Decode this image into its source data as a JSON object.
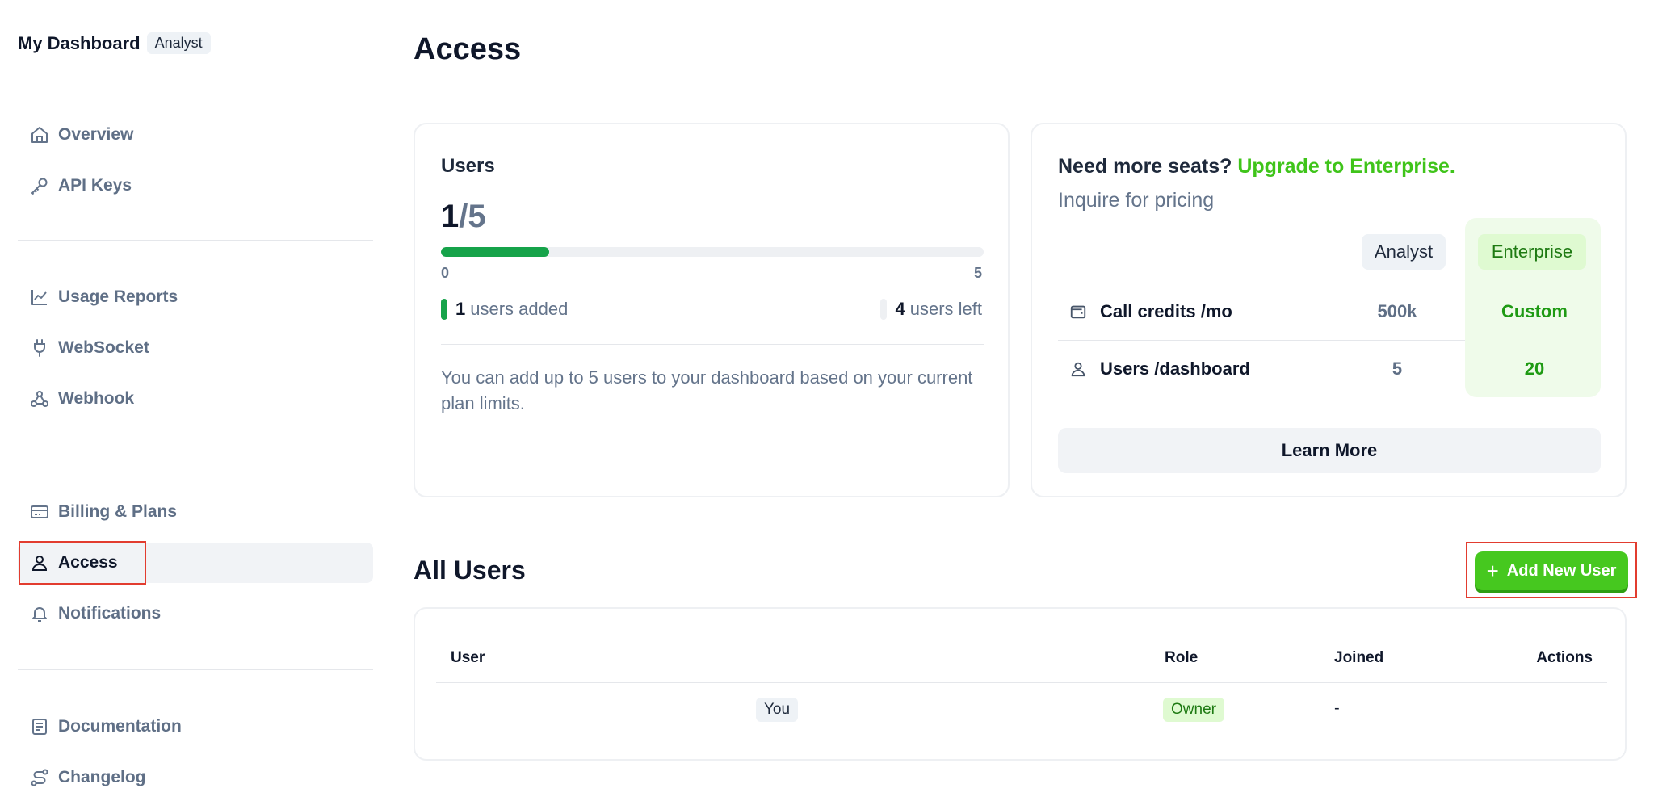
{
  "sidebar": {
    "brand_name": "My Dashboard",
    "brand_badge": "Analyst",
    "items": [
      {
        "label": "Overview",
        "icon": "home-icon"
      },
      {
        "label": "API Keys",
        "icon": "key-icon"
      },
      {
        "label": "Usage Reports",
        "icon": "chart-line-icon"
      },
      {
        "label": "WebSocket",
        "icon": "plug-icon"
      },
      {
        "label": "Webhook",
        "icon": "webhook-icon"
      },
      {
        "label": "Billing & Plans",
        "icon": "credit-card-icon"
      },
      {
        "label": "Access",
        "icon": "user-icon",
        "active": true
      },
      {
        "label": "Notifications",
        "icon": "bell-icon"
      },
      {
        "label": "Documentation",
        "icon": "book-icon"
      },
      {
        "label": "Changelog",
        "icon": "route-icon"
      }
    ]
  },
  "page": {
    "title": "Access"
  },
  "users_card": {
    "title": "Users",
    "current": "1",
    "total": "/5",
    "progress_fraction": 0.2,
    "min_label": "0",
    "max_label": "5",
    "added_count": "1",
    "added_label": "users added",
    "left_count": "4",
    "left_label": "users left",
    "description": "You can add up to 5 users to your dashboard based on your current plan limits."
  },
  "upgrade_card": {
    "heading": "Need more seats?",
    "heading_link": "Upgrade to Enterprise.",
    "subheading": "Inquire for pricing",
    "col_analyst": "Analyst",
    "col_enterprise": "Enterprise",
    "rows": [
      {
        "label": "Call credits /mo",
        "analyst": "500k",
        "enterprise": "Custom",
        "icon": "wallet-icon"
      },
      {
        "label": "Users /dashboard",
        "analyst": "5",
        "enterprise": "20",
        "icon": "user-icon"
      }
    ],
    "learn_more": "Learn More"
  },
  "all_users": {
    "title": "All Users",
    "add_button": "Add New User",
    "columns": [
      "User",
      "Role",
      "Joined",
      "Actions"
    ],
    "rows": [
      {
        "user": "You",
        "role": "Owner",
        "joined": "-"
      }
    ]
  },
  "colors": {
    "accent_green": "#46c81f",
    "progress_green": "#16a34a",
    "highlight_red": "#e23c2f"
  }
}
